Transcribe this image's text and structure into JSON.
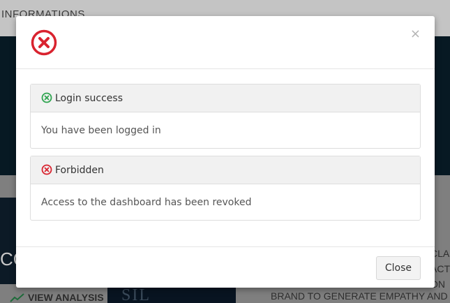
{
  "background": {
    "nav_link": "INFORMATIONS",
    "hero_fragment": "CO",
    "view_analysis_label": "VIEW ANALYSIS",
    "thumb_text": "SIL",
    "side_lines": [
      "CLA",
      "ACT",
      "ON"
    ],
    "brand_text": "BRAND TO GENERATE EMPATHY AND IN"
  },
  "modal": {
    "header_icon": "error-circle-icon",
    "close_x": "×",
    "messages": [
      {
        "title": "Login success",
        "icon": "check-circle-icon",
        "icon_color": "#2ea44f",
        "body": "You have been logged in"
      },
      {
        "title": "Forbidden",
        "icon": "error-circle-icon",
        "icon_color": "#d9232f",
        "body": "Access to the dashboard has been revoked"
      }
    ],
    "close_button": "Close"
  },
  "colors": {
    "error_red": "#d9232f",
    "success_green": "#2ea44f",
    "overlay_dark": "#071923"
  }
}
